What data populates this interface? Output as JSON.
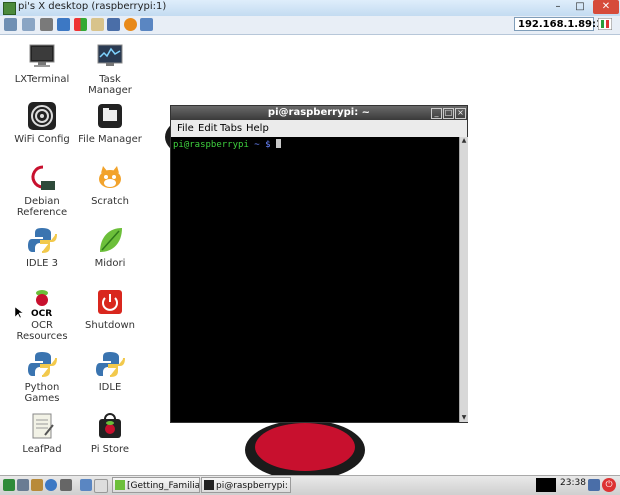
{
  "vnc": {
    "title": "pi's X desktop (raspberrypi:1)",
    "host": "192.168.1.89:1",
    "minimize": "–",
    "maximize": "□",
    "close": "✕"
  },
  "desktop_icons": [
    {
      "label": "LXTerminal",
      "icon": "terminal-icon"
    },
    {
      "label": "Task Manager",
      "icon": "task-manager-icon"
    },
    {
      "label": "WiFi Config",
      "icon": "wifi-icon"
    },
    {
      "label": "File Manager",
      "icon": "file-manager-icon"
    },
    {
      "label": "Debian Reference",
      "icon": "debian-icon"
    },
    {
      "label": "Scratch",
      "icon": "scratch-cat-icon"
    },
    {
      "label": "IDLE 3",
      "icon": "python-icon"
    },
    {
      "label": "Midori",
      "icon": "midori-leaf-icon"
    },
    {
      "label": "OCR Resources",
      "icon": "raspberry-ocr-icon"
    },
    {
      "label": "Shutdown",
      "icon": "power-icon"
    },
    {
      "label": "Python Games",
      "icon": "python-icon"
    },
    {
      "label": "IDLE",
      "icon": "python-icon"
    },
    {
      "label": "LeafPad",
      "icon": "notepad-icon"
    },
    {
      "label": "Pi Store",
      "icon": "pi-store-icon"
    }
  ],
  "terminal": {
    "title": "pi@raspberrypi: ~",
    "menu": [
      "File",
      "Edit",
      "Tabs",
      "Help"
    ],
    "prompt_user": "pi@raspberrypi",
    "prompt_rest": " ~ $ "
  },
  "taskbar": {
    "tasks": [
      "[Getting_Familiar...",
      "pi@raspberrypi: ~"
    ],
    "clock": "23:38"
  },
  "colors": {
    "prompt": "#3fd13f",
    "accent_red": "#c8102e",
    "desktop_bg": "#ffffff"
  }
}
